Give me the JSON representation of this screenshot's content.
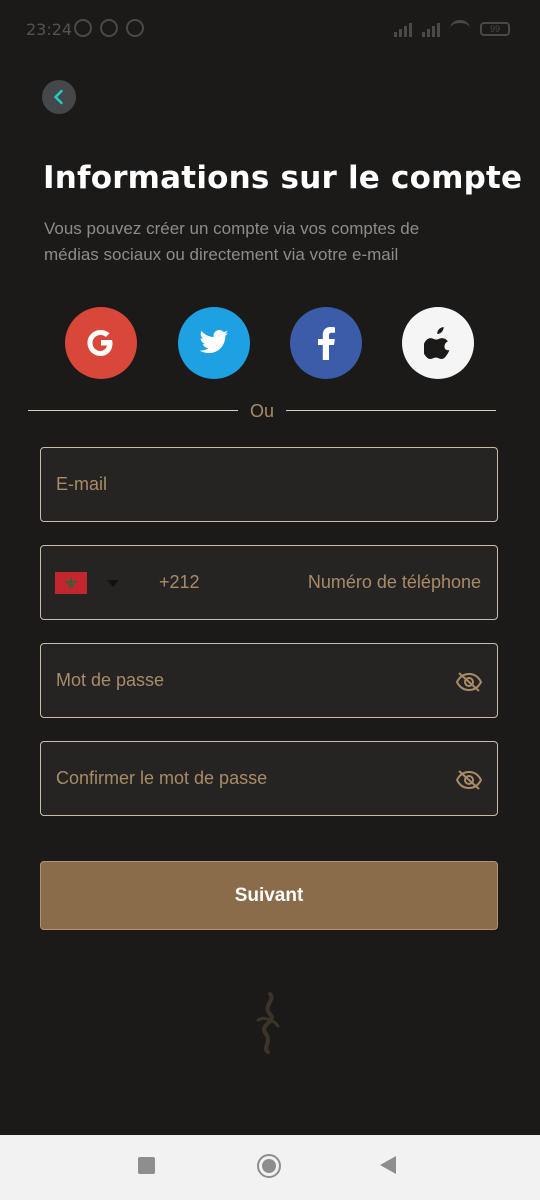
{
  "status_bar": {
    "time": "23:24",
    "battery": "99"
  },
  "header": {
    "title": "Informations sur le compte",
    "subtitle": "Vous pouvez créer un compte via vos comptes de médias sociaux ou directement via votre e-mail"
  },
  "social": {
    "buttons": [
      {
        "name": "google",
        "glyph": "G",
        "color": "#d9473a"
      },
      {
        "name": "twitter",
        "color": "#1da1e2"
      },
      {
        "name": "facebook",
        "glyph": "f",
        "color": "#3b5ca8"
      },
      {
        "name": "apple",
        "color": "#f5f5f5"
      }
    ]
  },
  "divider": {
    "label": "Ou"
  },
  "form": {
    "email_placeholder": "E-mail",
    "phone": {
      "dial_code": "+212",
      "placeholder": "Numéro de téléphone",
      "country_flag": "morocco-flag"
    },
    "password_placeholder": "Mot de passe",
    "confirm_placeholder": "Confirmer le mot de passe"
  },
  "actions": {
    "next_label": "Suivant"
  },
  "colors": {
    "accent": "#a98b68",
    "button": "#8a6b4a",
    "background": "#1b1a19"
  }
}
